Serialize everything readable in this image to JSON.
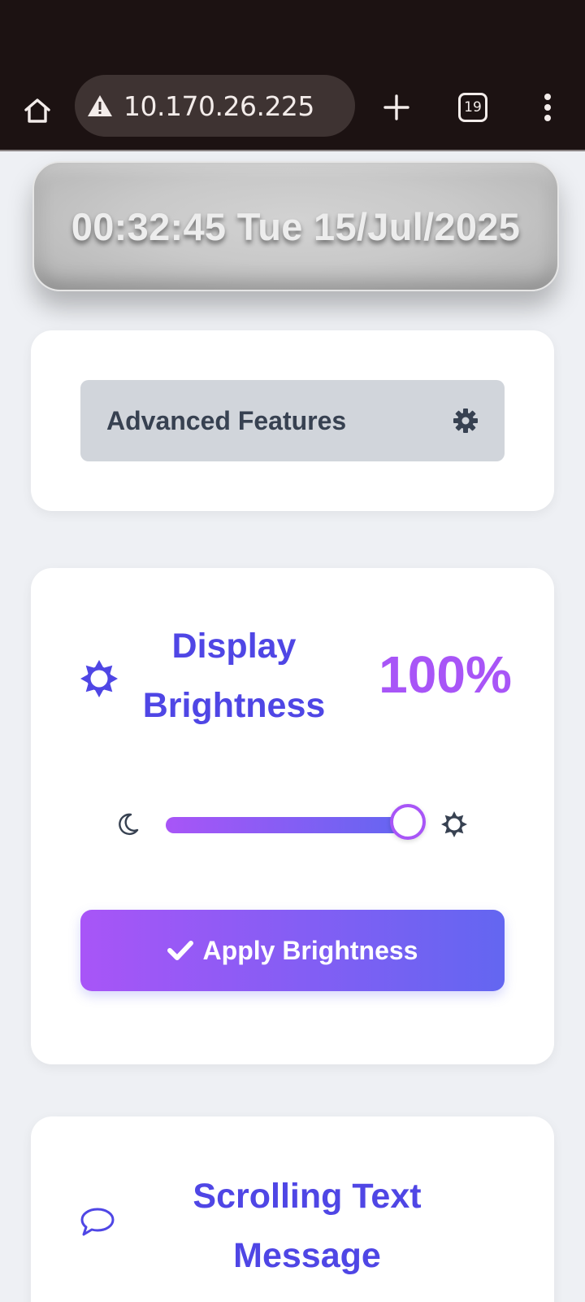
{
  "browser": {
    "url": "10.170.26.225",
    "tab_count": "19",
    "icons": {
      "home": "home-icon",
      "warning": "warning-icon",
      "new_tab": "plus-icon",
      "tabs": "tabs-icon",
      "menu": "more-vert-icon"
    }
  },
  "clock": {
    "text": "00:32:45 Tue 15/Jul/2025"
  },
  "advanced": {
    "label": "Advanced Features",
    "icon": "gear-icon"
  },
  "brightness": {
    "title": "Display Brightness",
    "value_text": "100%",
    "level": 1.0,
    "min_icon": "moon-icon",
    "max_icon": "sun-icon",
    "apply_label": "Apply Brightness",
    "apply_icon": "check-icon"
  },
  "scrolling": {
    "title": "Scrolling Text Message",
    "icon": "chat-bubble-icon"
  },
  "colors": {
    "chrome_bg": "#1c1212",
    "accent_indigo": "#4f46e5",
    "accent_purple": "#a855f7",
    "gradient_end": "#6366f1",
    "card_bg": "#ffffff",
    "page_bg": "#eef0f4"
  }
}
